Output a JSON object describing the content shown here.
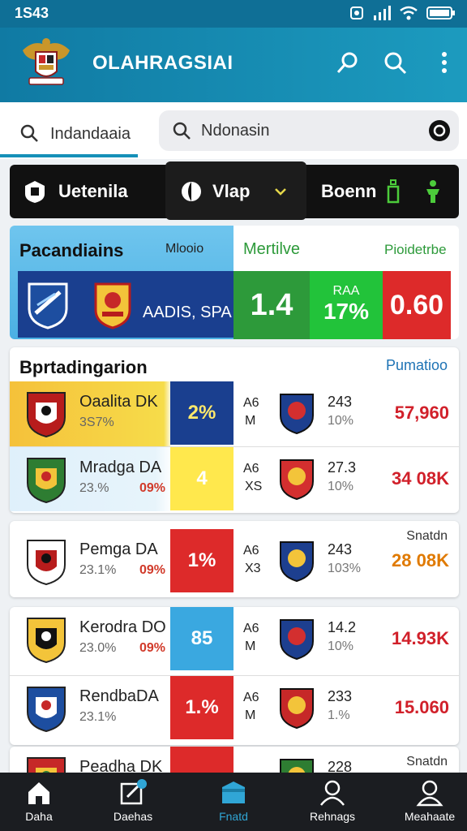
{
  "status": {
    "time": "1S43"
  },
  "appbar": {
    "title": "OLAHRAGSIAI"
  },
  "search": {
    "field1": "Indandaaia",
    "field2": "Ndonasin"
  },
  "tabs": [
    {
      "label": "Uetenila",
      "icon": "shield-icon"
    },
    {
      "label": "Vlap",
      "icon": "ball-icon"
    },
    {
      "label": "Boenn",
      "icon": "bottle-icon"
    }
  ],
  "summary": {
    "title": "Pacandiains",
    "subtitle": "Mlooio",
    "team_text": "AADIS, SPA",
    "metric_label": "Mertilve",
    "metric_value": "1.4",
    "share_label": "RAA",
    "share_value": "17%",
    "right_label": "Pioidetrbe",
    "right_value": "0.60"
  },
  "section1": {
    "title": "Bprtadingarion",
    "link": "Pumatioo"
  },
  "rows": [
    {
      "name": "Oaalita DK",
      "sub": "3S7%",
      "extra": "",
      "pct": "2%",
      "a1": "A6",
      "a2": "M",
      "n1": "243",
      "n2": "10%",
      "val": "57,960",
      "val_color": "#d1202a",
      "pct_bg": "#1a3f8f",
      "pct_fg": "#ffe96b"
    },
    {
      "name": "Mradga DA",
      "sub": "23.%",
      "extra": "09%",
      "pct": "4",
      "a1": "A6",
      "a2": "XS",
      "n1": "27.3",
      "n2": "10%",
      "val": "34 08K",
      "val_color": "#d1202a",
      "pct_bg": "#ffe84d",
      "pct_fg": "#ffffff"
    },
    {
      "name": "Pemga DA",
      "sub": "23.1%",
      "extra": "09%",
      "pct": "1%",
      "a1": "A6",
      "a2": "X3",
      "n1": "243",
      "n2": "103%",
      "val": "28 08K",
      "val_color": "#e07a00",
      "pct_bg": "#dd2a2a",
      "pct_fg": "#ffffff"
    },
    {
      "name": "Kerodra DO",
      "sub": "23.0%",
      "extra": "09%",
      "pct": "85",
      "a1": "A6",
      "a2": "M",
      "n1": "14.2",
      "n2": "10%",
      "val": "14.93K",
      "val_color": "#d1202a",
      "pct_bg": "#3aa8e0",
      "pct_fg": "#ffffff"
    },
    {
      "name": "RendbaDA",
      "sub": "23.1%",
      "extra": "",
      "pct": "1.%",
      "a1": "A6",
      "a2": "M",
      "n1": "233",
      "n2": "1.%",
      "val": "15.060",
      "val_color": "#d1202a",
      "pct_bg": "#dd2a2a",
      "pct_fg": "#ffffff"
    },
    {
      "name": "Peadha DK",
      "sub": "",
      "extra": "",
      "pct": "",
      "a1": "",
      "a2": "",
      "n1": "228",
      "n2": "",
      "val": "",
      "val_color": "#222222",
      "pct_bg": "#dd2a2a",
      "pct_fg": "#ffffff"
    }
  ],
  "card2": {
    "corner": "Snatdn"
  },
  "card4": {
    "corner": "Snatdn"
  },
  "nav": [
    {
      "label": "Daha",
      "icon": "home-icon"
    },
    {
      "label": "Daehas",
      "icon": "edit-icon"
    },
    {
      "label": "Fnatd",
      "icon": "folder-icon"
    },
    {
      "label": "Rehnags",
      "icon": "profile-icon"
    },
    {
      "label": "Meahaate",
      "icon": "account-icon"
    }
  ],
  "colors": {
    "appbar": "#1590b8",
    "summary_blue": "#1a3f8f",
    "summary_green": "#2d9a3a",
    "summary_red": "#dd2a2a",
    "nav_active": "#30a6d6"
  }
}
